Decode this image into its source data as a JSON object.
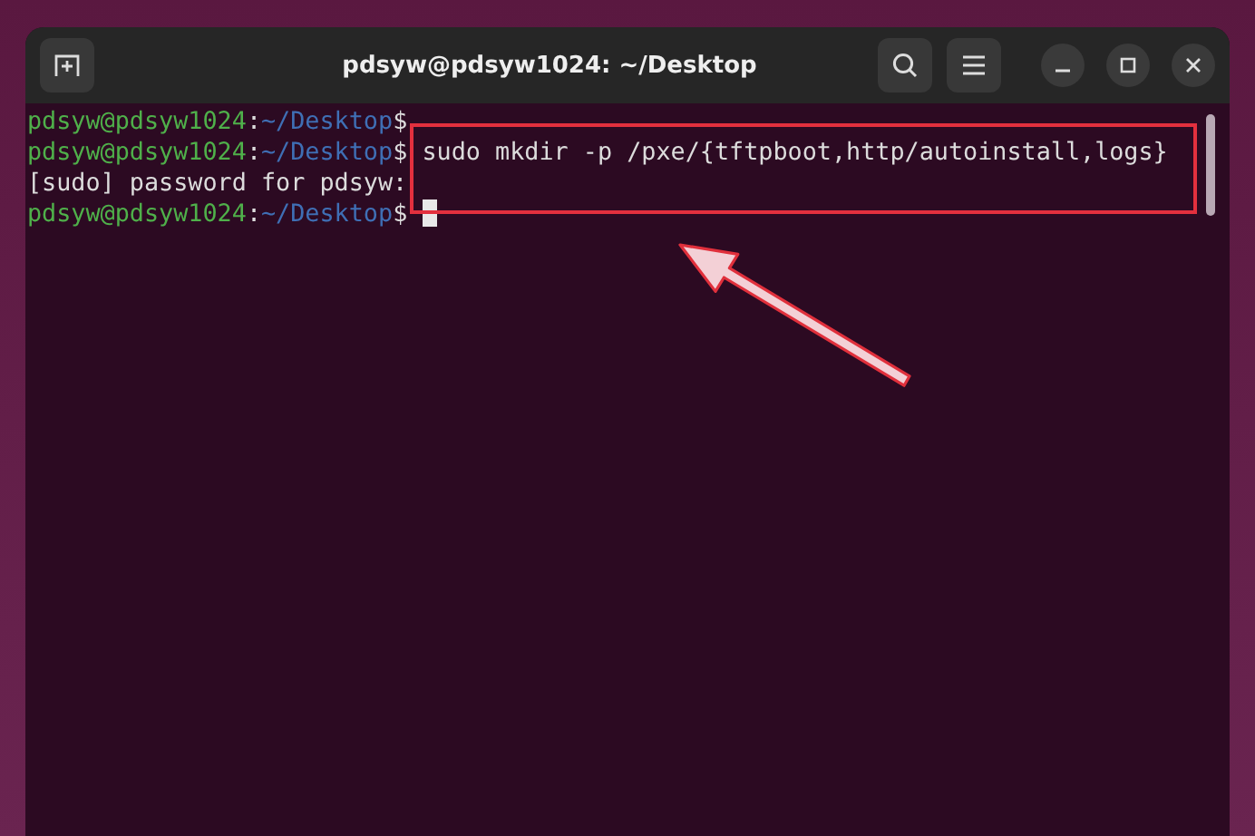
{
  "window": {
    "title": "pdsyw@pdsyw1024: ~/Desktop"
  },
  "terminal": {
    "lines": [
      {
        "kind": "prompt",
        "user_host": "pdsyw@pdsyw1024",
        "separator": ":",
        "path": "~/Desktop",
        "symbol": "$",
        "highlighted": false,
        "cursor": false
      },
      {
        "kind": "prompt",
        "user_host": "pdsyw@pdsyw1024",
        "separator": ":",
        "path": "~/Desktop",
        "symbol": "$",
        "command": "sudo mkdir -p /pxe/{tftpboot,http/autoinstall,logs}",
        "highlighted": true,
        "cursor": false
      },
      {
        "kind": "output",
        "text": "[sudo] password for pdsyw:"
      },
      {
        "kind": "prompt",
        "user_host": "pdsyw@pdsyw1024",
        "separator": ":",
        "path": "~/Desktop",
        "symbol": "$",
        "highlighted": false,
        "cursor": true
      }
    ]
  }
}
